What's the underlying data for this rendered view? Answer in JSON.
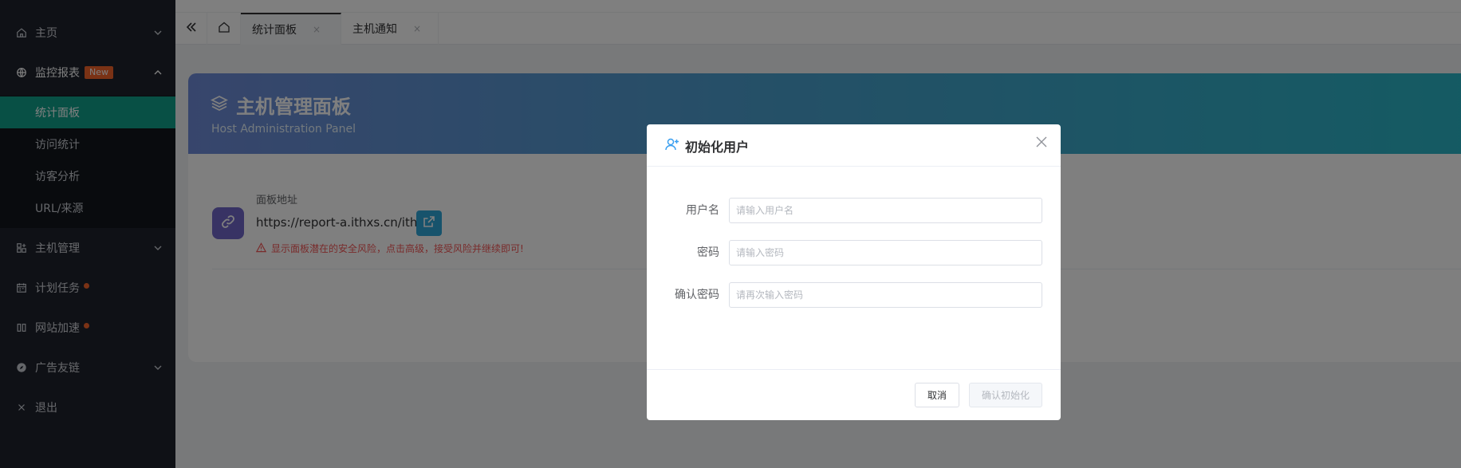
{
  "sidebar": {
    "menu": [
      {
        "label": "主页",
        "icon": "home-icon",
        "arrow": "down"
      },
      {
        "label": "监控报表",
        "icon": "globe-icon",
        "arrow": "up",
        "badge": "New"
      },
      {
        "label": "主机管理",
        "icon": "apps-icon",
        "arrow": "down"
      },
      {
        "label": "计划任务",
        "icon": "calendar-icon",
        "dot": true
      },
      {
        "label": "网站加速",
        "icon": "columns-icon",
        "dot": true
      },
      {
        "label": "广告友链",
        "icon": "compass-icon",
        "arrow": "down"
      },
      {
        "label": "退出",
        "icon": "close-icon"
      }
    ],
    "submenu": [
      {
        "label": "统计面板",
        "active": true
      },
      {
        "label": "访问统计"
      },
      {
        "label": "访客分析"
      },
      {
        "label": "URL/来源"
      }
    ]
  },
  "tabbar": {
    "tabs": [
      {
        "label": "统计面板",
        "active": true
      },
      {
        "label": "主机通知"
      }
    ],
    "close_glyph": "×"
  },
  "panel": {
    "title": "主机管理面板",
    "subtitle": "Host Administration Panel",
    "address_label": "面板地址",
    "address_url": "https://report-a.ithxs.cn/ithxs",
    "warning": "显示面板潜在的安全风险，点击高级，接受风险并继续即可!"
  },
  "dialog": {
    "title": "初始化用户",
    "fields": [
      {
        "label": "用户名",
        "placeholder": "请输入用户名",
        "value": ""
      },
      {
        "label": "密码",
        "placeholder": "请输入密码",
        "value": ""
      },
      {
        "label": "确认密码",
        "placeholder": "请再次输入密码",
        "value": ""
      }
    ],
    "cancel_label": "取消",
    "confirm_label": "确认初始化"
  },
  "colors": {
    "sidebar_bg": "#1e222d",
    "active_green": "#11a08b",
    "badge_orange": "#f5642a",
    "warning_red": "#f35757",
    "dialog_icon_blue": "#3a9ff0"
  }
}
